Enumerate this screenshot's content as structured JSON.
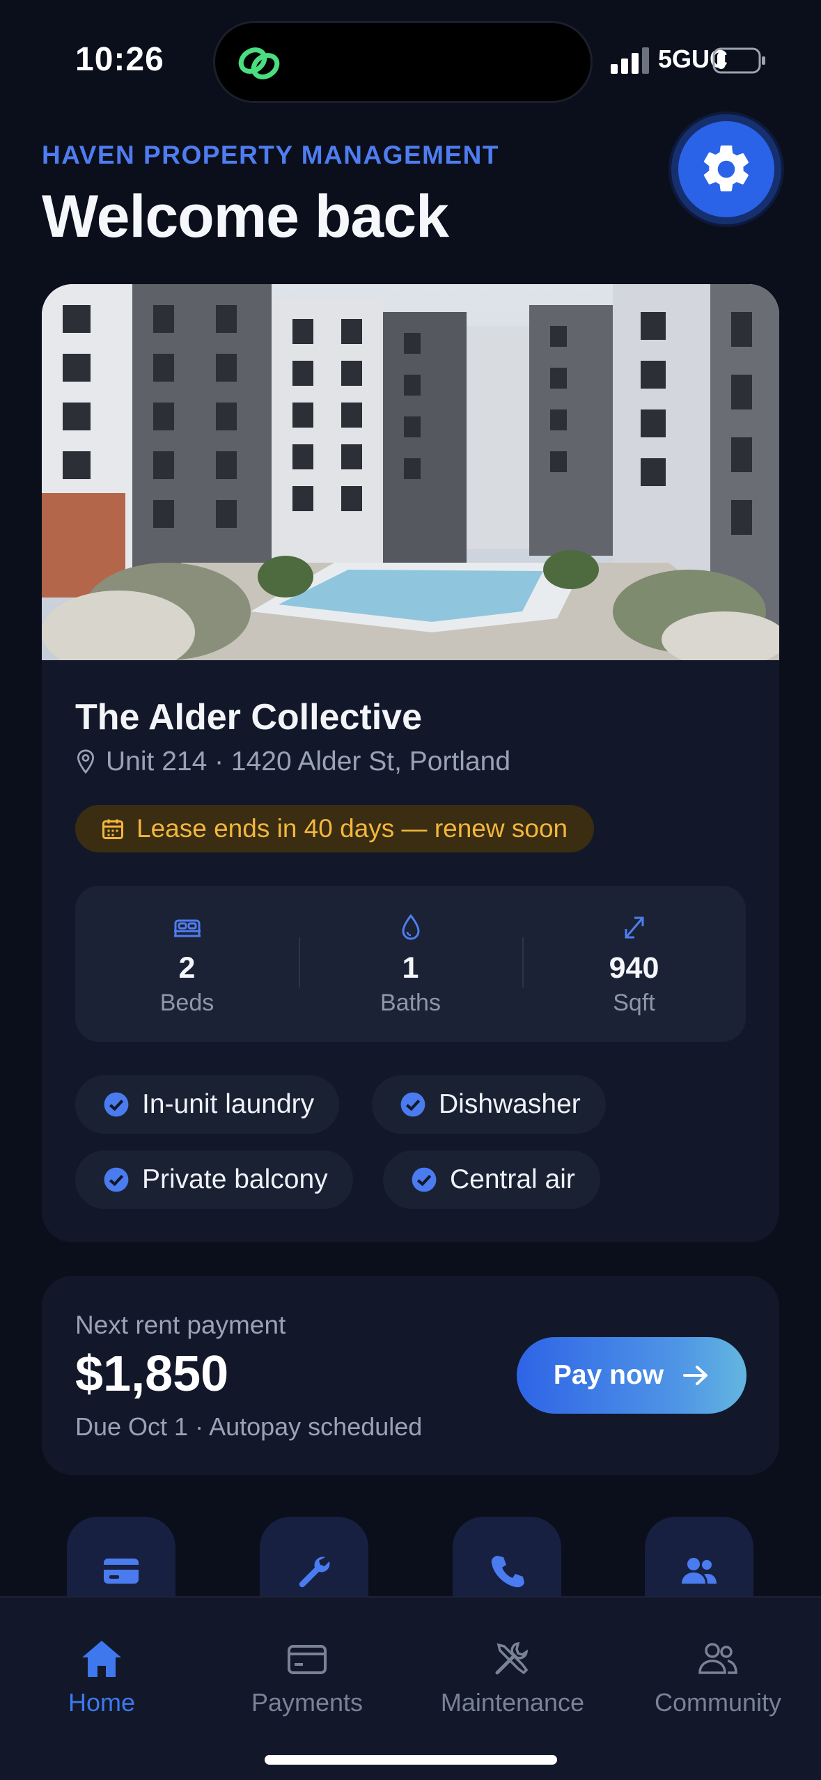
{
  "status_bar": {
    "time": "10:26",
    "network": "5GUC",
    "battery_level_fraction": 0.2
  },
  "header": {
    "brand": "HAVEN PROPERTY MANAGEMENT",
    "greeting": "Welcome back",
    "settings_icon": "gear-icon"
  },
  "property": {
    "name": "The Alder Collective",
    "address": "Unit 214 · 1420 Alder St, Portland",
    "lease_notice": "Lease ends in 40 days — renew soon",
    "stats": [
      {
        "value": "2",
        "label": "Beds",
        "icon": "bed-icon"
      },
      {
        "value": "1",
        "label": "Baths",
        "icon": "droplet-icon"
      },
      {
        "value": "940",
        "label": "Sqft",
        "icon": "expand-icon"
      }
    ],
    "amenities": [
      "In-unit laundry",
      "Dishwasher",
      "Private balcony",
      "Central air"
    ]
  },
  "rent": {
    "label": "Next rent payment",
    "amount": "$1,850",
    "due": "Due Oct 1 · Autopay scheduled",
    "pay_label": "Pay now"
  },
  "quick_actions": [
    "card-icon",
    "wrench-icon",
    "phone-icon",
    "users-icon"
  ],
  "tabs": [
    {
      "label": "Home",
      "icon": "home-icon",
      "active": true
    },
    {
      "label": "Payments",
      "icon": "card-icon",
      "active": false
    },
    {
      "label": "Maintenance",
      "icon": "tools-icon",
      "active": false
    },
    {
      "label": "Community",
      "icon": "users-icon",
      "active": false
    }
  ],
  "colors": {
    "background": "#0b0f1c",
    "card": "#121829",
    "accent": "#2a63e8",
    "warning": "#f4b63b"
  }
}
